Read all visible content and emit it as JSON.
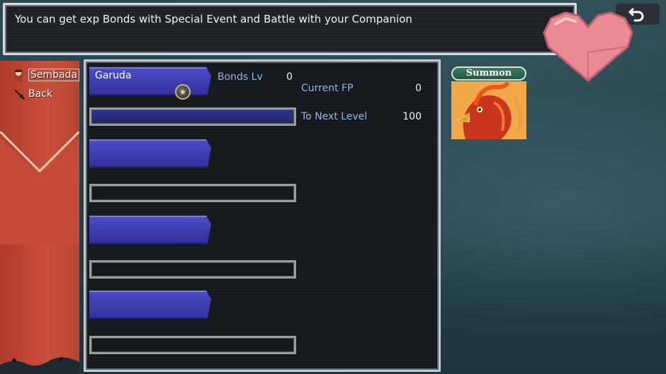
{
  "message": "You can get exp Bonds with Special Event and Battle with your Companion",
  "sidebar": {
    "items": [
      {
        "label": "Sembada",
        "icon": "character-icon",
        "selected": true
      },
      {
        "label": "Back",
        "icon": "sword-icon",
        "selected": false
      }
    ]
  },
  "list": {
    "rows": [
      {
        "name": "Garuda",
        "bond_progress": 1.0
      },
      {
        "name": "",
        "bond_progress": 0
      },
      {
        "name": "",
        "bond_progress": 0
      },
      {
        "name": "",
        "bond_progress": 0
      }
    ]
  },
  "stats": {
    "bonds_lv_label": "Bonds Lv",
    "bonds_lv_value": "0",
    "current_fp_label": "Current FP",
    "current_fp_value": "0",
    "to_next_label": "To Next Level",
    "to_next_value": "100"
  },
  "summon": {
    "label": "Summon"
  },
  "colors": {
    "tab_blue": "#3d3cae",
    "label_blue": "#8fb6e8",
    "ribbon_red": "#c9503d",
    "heart_pink": "#e98a94"
  },
  "icons": {
    "return": "return-arrow-icon",
    "heart": "heart-icon",
    "star": "star-badge-icon"
  }
}
